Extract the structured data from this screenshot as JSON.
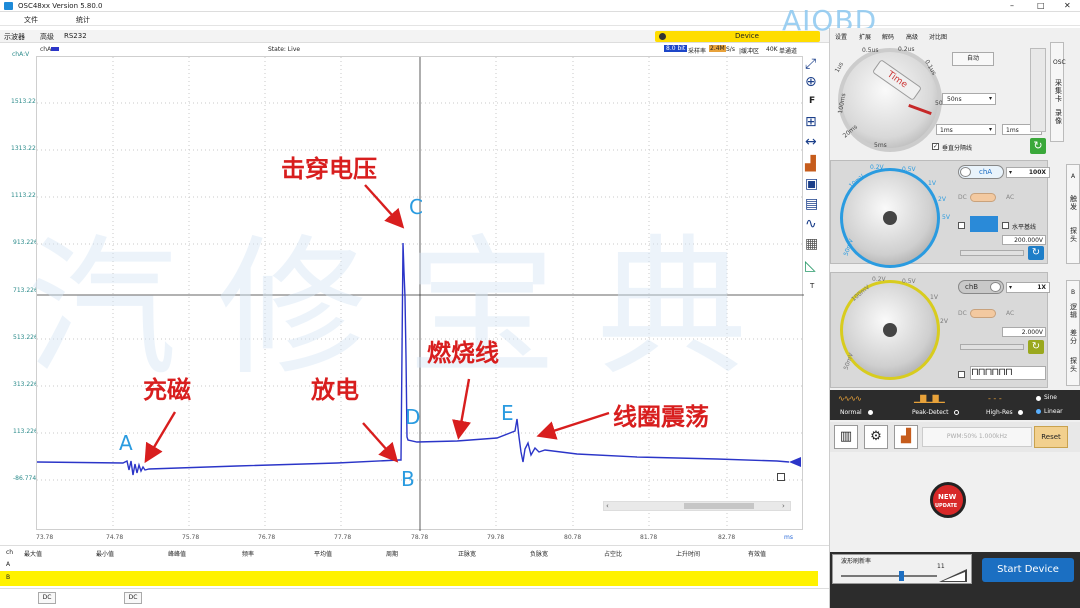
{
  "window": {
    "title": "OSC48xx  Version 5.80.0",
    "controls": [
      "–",
      "□",
      "✕"
    ]
  },
  "menu": [
    "文件",
    "统计"
  ],
  "tabs": [
    "示波器",
    "高级",
    "RS232"
  ],
  "device_label": "Device",
  "status": {
    "channel": "chA",
    "state": "State: Live",
    "bits": "8.0 bit",
    "sample_label": "采样率",
    "sample_rate": "2.4M",
    "sample_unit": "S/s",
    "buffer": "|缓冲区",
    "depth": "40K",
    "mode": "单通道"
  },
  "y_axis": {
    "label": "chA:V",
    "ticks": [
      "1513.226",
      "1313.226",
      "1113.226",
      "913.226",
      "713.226",
      "513.226",
      "313.226",
      "113.226",
      "-86.774"
    ]
  },
  "x_axis": {
    "ticks": [
      "73.78",
      "74.78",
      "75.78",
      "76.78",
      "77.78",
      "78.78",
      "79.78",
      "80.78",
      "81.78",
      "82.78"
    ],
    "unit": "ms"
  },
  "watermark": {
    "brand": "AIOBD",
    "chars": [
      "汽",
      "修",
      "宝",
      "典"
    ]
  },
  "annotations": {
    "breakdown": "击穿电压",
    "magnetize": "充磁",
    "discharge": "放电",
    "burn": "燃烧线",
    "ring": "线圈震荡",
    "points": {
      "A": "A",
      "B": "B",
      "C": "C",
      "D": "D",
      "E": "E"
    }
  },
  "measure_headers": [
    "ch",
    "最大值",
    "最小值",
    "峰峰值",
    "频率",
    "平均值",
    "周期",
    "正脉宽",
    "负脉宽",
    "占空比",
    "上升时间",
    "有效值"
  ],
  "measure_rows": [
    "A",
    "B"
  ],
  "footer": {
    "dc1": "DC",
    "dc2": "DC"
  },
  "right_panel": {
    "tabs": [
      "设置",
      "扩展",
      "解码",
      "高级",
      "对比图"
    ],
    "vtabs_top": [
      "OSC",
      "采集卡",
      "录像"
    ],
    "vtabs_mid": [
      "A",
      "触发",
      "探头"
    ],
    "vtabs_bot": [
      "B",
      "逻辑",
      "差分",
      "探头"
    ],
    "time": {
      "auto": "自动",
      "dial_label": "Time",
      "scale_labels": [
        "1us",
        "0.5us",
        "0.2us",
        "0.1us",
        "50ns",
        "100ms",
        "20ms",
        "5ms"
      ],
      "timebase": "50ns",
      "time1": "1ms",
      "time2": "1ms",
      "grid_label": "垂直分隔线",
      "grid_checked": true
    },
    "chA": {
      "name": "chA",
      "probe": "100X",
      "dc": "DC",
      "ac": "AC",
      "baseline_label": "水平基线",
      "offset": "200.000V",
      "scale_labels": [
        "50mV",
        "20mV",
        "10mV",
        "0.1V",
        "0.2V",
        "0.5V",
        "1V",
        "2V",
        "5V"
      ]
    },
    "chB": {
      "name": "chB",
      "probe": "1X",
      "dc": "DC",
      "ac": "AC",
      "offset": "2.000V",
      "scale_labels": [
        "50mV",
        "20mV",
        "100mV",
        "0.2V",
        "0.5V",
        "1V",
        "2V"
      ]
    },
    "acq_modes": [
      "Normal",
      "Peak-Detect",
      "High-Res"
    ],
    "wave_modes": [
      "Sine",
      "Linear"
    ],
    "pwm": "PWM:50% 1.000kHz",
    "reset": "Reset",
    "new_badge": [
      "NEW",
      "UPDATE"
    ],
    "refresh_label": "波形刷新率",
    "refresh_value": "11",
    "start_btn": "Start Device"
  },
  "colors": {
    "trace": "#2b35c8",
    "annotation": "#d81e1e",
    "point": "#2a9be0",
    "device": "#ffdd00",
    "start": "#1b6fc2"
  }
}
